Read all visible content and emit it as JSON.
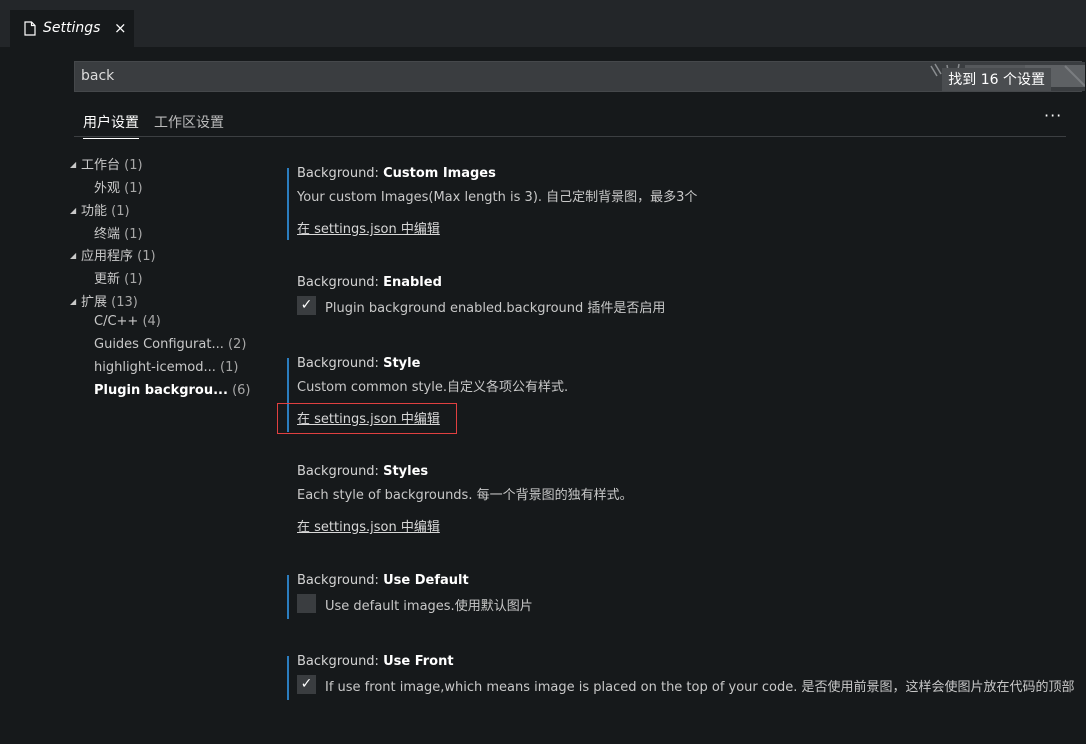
{
  "tab": {
    "title": "Settings",
    "close": "×",
    "icon": "file-icon"
  },
  "search": {
    "value": "back",
    "result_count": "找到 16 个设置"
  },
  "scopes": {
    "user": "用户设置",
    "workspace": "工作区设置",
    "more": "···"
  },
  "toc": [
    {
      "label": "工作台",
      "count": "(1)",
      "expanded": true,
      "level": 0
    },
    {
      "label": "外观",
      "count": "(1)",
      "level": 1
    },
    {
      "label": "功能",
      "count": "(1)",
      "expanded": true,
      "level": 0
    },
    {
      "label": "终端",
      "count": "(1)",
      "level": 1
    },
    {
      "label": "应用程序",
      "count": "(1)",
      "expanded": true,
      "level": 0
    },
    {
      "label": "更新",
      "count": "(1)",
      "level": 1
    },
    {
      "label": "扩展",
      "count": "(13)",
      "expanded": true,
      "level": 0
    },
    {
      "label": "C/C++",
      "count": "(4)",
      "level": 1
    },
    {
      "label": "Guides Configurat...",
      "count": "(2)",
      "level": 1
    },
    {
      "label": "highlight-icemod...",
      "count": "(1)",
      "level": 1
    },
    {
      "label": "Plugin backgrou...",
      "count": "(6)",
      "level": 1,
      "active": true
    }
  ],
  "settings": [
    {
      "category": "Background: ",
      "name": "Custom Images",
      "desc": "Your custom Images(Max length is 3). 自己定制背景图，最多3个",
      "link": "在 settings.json 中编辑"
    },
    {
      "category": "Background: ",
      "name": "Enabled",
      "checkbox_label": "Plugin background enabled.background 插件是否启用",
      "checked": "✓"
    },
    {
      "category": "Background: ",
      "name": "Style",
      "desc": "Custom common style.自定义各项公有样式.",
      "link": "在 settings.json 中编辑"
    },
    {
      "category": "Background: ",
      "name": "Styles",
      "desc": "Each style of backgrounds. 每一个背景图的独有样式。",
      "link": "在 settings.json 中编辑"
    },
    {
      "category": "Background: ",
      "name": "Use Default",
      "checkbox_label": "Use default images.使用默认图片",
      "checked": ""
    },
    {
      "category": "Background: ",
      "name": "Use Front",
      "checkbox_label": "If use front image,which means image is placed on the top of your code. 是否使用前景图，这样会使图片放在代码的顶部",
      "checked": "✓"
    }
  ],
  "colors": {
    "accent": "#2b7dbf",
    "highlight": "#e04040",
    "background": "#16191b"
  }
}
